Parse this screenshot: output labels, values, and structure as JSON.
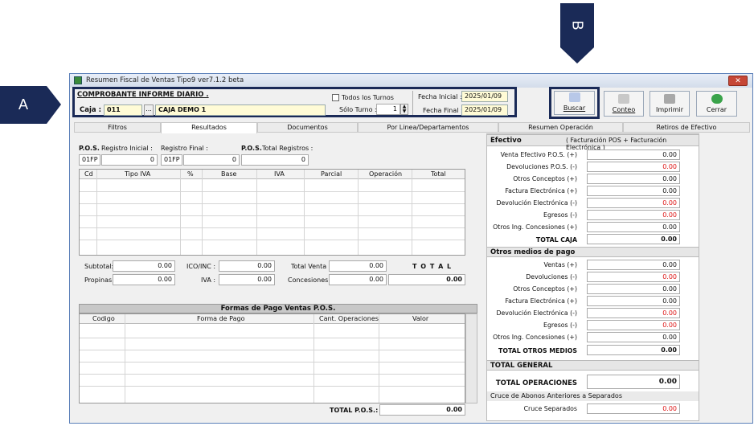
{
  "callouts": {
    "a": "A",
    "b": "B"
  },
  "window": {
    "title": "Resumen Fiscal de Ventas Tipo9 ver7.1.2 beta",
    "close": "✕"
  },
  "header": {
    "comprobante": "COMPROBANTE  INFORME DIARIO .",
    "caja_label": "Caja :",
    "caja_code": "011",
    "caja_more": "...",
    "caja_name": "CAJA DEMO 1",
    "todos_turnos": "Todos los Turnos",
    "solo_turno_label": "Sólo Turno :",
    "solo_turno_value": "1",
    "fecha_inicial_label": "Fecha Inicial :",
    "fecha_inicial": "2025/01/09",
    "fecha_final_label": "Fecha Final :",
    "fecha_final": "2025/01/09"
  },
  "toolbar": {
    "buscar": "Buscar",
    "conteo": "Conteo",
    "imprimir": "Imprimir",
    "cerrar": "Cerrar"
  },
  "tabs": [
    "Filtros",
    "Resultados",
    "Documentos",
    "Por Linea/Departamentos",
    "Resumen Operación",
    "Retiros de Efectivo"
  ],
  "pos": {
    "pos_label": "P.O.S.",
    "registro_inicial": "Registro Inicial :",
    "registro_final": "Registro Final :",
    "pos_label2": "P.O.S.",
    "total_registros": "Total Registros :",
    "pos1": "01FP",
    "ini": "0",
    "pos2": "01FP",
    "fin": "0",
    "total": "0"
  },
  "iva_table": {
    "columns": [
      "Cd",
      "Tipo IVA",
      "%",
      "Base",
      "IVA",
      "Parcial",
      "Operación",
      "Total"
    ]
  },
  "totals": {
    "subtotal_label": "Subtotal:",
    "subtotal": "0.00",
    "ico_label": "ICO/INC :",
    "ico": "0.00",
    "total_venta_label": "Total Venta :",
    "total_venta": "0.00",
    "total_label": "T O T A L",
    "propinas_label": "Propinas:",
    "propinas": "0.00",
    "iva_label": "IVA :",
    "iva": "0.00",
    "concesiones_label": "Concesiones :",
    "concesiones": "0.00",
    "total": "0.00"
  },
  "formas_pago": {
    "title": "Formas de Pago Ventas  P.O.S.",
    "columns": [
      "Codigo",
      "Forma de Pago",
      "Cant. Operaciones",
      "Valor"
    ],
    "total_label": "TOTAL  P.O.S.:",
    "total": "0.00"
  },
  "efectivo": {
    "title": "Efectivo",
    "subtitle": "( Facturación POS + Facturación Electrónica )",
    "rows": [
      {
        "label": "Venta Efectivo P.O.S. (+)",
        "value": "0.00",
        "color": "#111111"
      },
      {
        "label": "Devoluciones P.O.S.  (-)",
        "value": "0.00",
        "color": "#dd1111"
      },
      {
        "label": "Otros Conceptos (+)",
        "value": "0.00",
        "color": "#111111"
      },
      {
        "label": "Factura Electrónica (+)",
        "value": "0.00",
        "color": "#111111"
      },
      {
        "label": "Devolución Electrónica  (-)",
        "value": "0.00",
        "color": "#dd1111"
      },
      {
        "label": "Egresos  (-)",
        "value": "0.00",
        "color": "#dd1111"
      },
      {
        "label": "Otros Ing. Concesiones (+)",
        "value": "0.00",
        "color": "#111111"
      }
    ],
    "total_label": "TOTAL CAJA",
    "total": "0.00"
  },
  "otros": {
    "title": "Otros medios de pago",
    "rows": [
      {
        "label": "Ventas    (+)",
        "value": "0.00",
        "color": "#111111"
      },
      {
        "label": "Devoluciones    (-)",
        "value": "0.00",
        "color": "#dd1111"
      },
      {
        "label": "Otros Conceptos (+)",
        "value": "0.00",
        "color": "#111111"
      },
      {
        "label": "Factura Electrónica (+)",
        "value": "0.00",
        "color": "#111111"
      },
      {
        "label": "Devolución Electrónica (-)",
        "value": "0.00",
        "color": "#dd1111"
      },
      {
        "label": "Egresos  (-)",
        "value": "0.00",
        "color": "#dd1111"
      },
      {
        "label": "Otros Ing. Concesiones (+)",
        "value": "0.00",
        "color": "#111111"
      }
    ],
    "total_label": "TOTAL OTROS MEDIOS",
    "total": "0.00"
  },
  "general": {
    "title": "TOTAL GENERAL",
    "ops_label": "TOTAL OPERACIONES",
    "ops": "0.00",
    "cruce_title": "Cruce de Abonos Anteriores a Separados",
    "cruce_label": "Cruce Separados",
    "cruce": "0.00"
  }
}
